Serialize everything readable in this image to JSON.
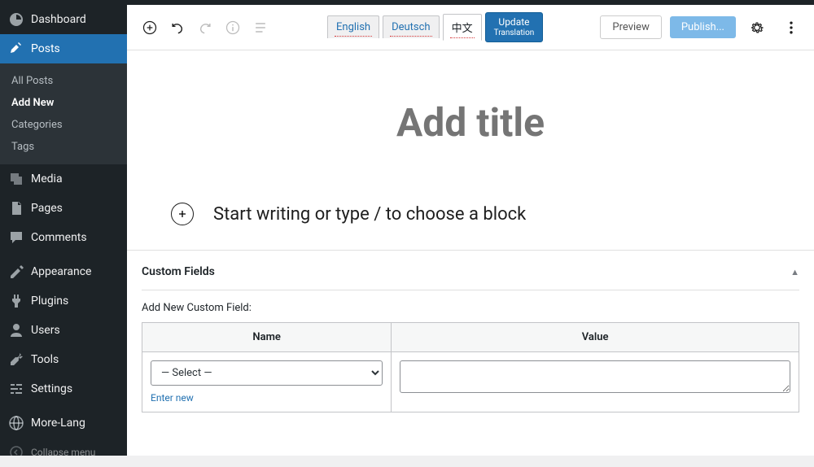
{
  "sidebar": {
    "dashboard": "Dashboard",
    "posts": {
      "label": "Posts",
      "sub": [
        "All Posts",
        "Add New",
        "Categories",
        "Tags"
      ],
      "current": "Add New"
    },
    "media": "Media",
    "pages": "Pages",
    "comments": "Comments",
    "appearance": "Appearance",
    "plugins": "Plugins",
    "users": "Users",
    "tools": "Tools",
    "settings": "Settings",
    "morelang": "More-Lang",
    "collapse": "Collapse menu"
  },
  "toolbar": {
    "languages": [
      "English",
      "Deutsch",
      "中文"
    ],
    "active_lang_index": 2,
    "update": "Update",
    "update_sub": "Translation",
    "preview": "Preview",
    "publish": "Publish..."
  },
  "editor": {
    "title_placeholder": "Add title",
    "block_prompt": "Start writing or type / to choose a block"
  },
  "custom_fields": {
    "panel_title": "Custom Fields",
    "add_new_label": "Add New Custom Field:",
    "col_name": "Name",
    "col_value": "Value",
    "select_placeholder": "— Select —",
    "enter_new": "Enter new"
  }
}
